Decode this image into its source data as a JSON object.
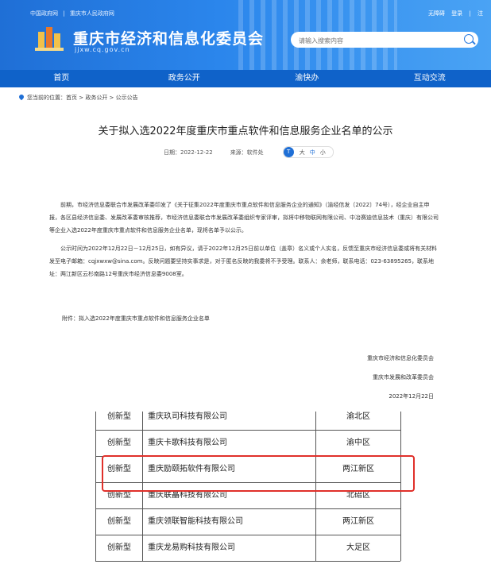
{
  "header": {
    "top_links": [
      "中国政府网",
      "|",
      "重庆市人民政府网"
    ],
    "user_links": [
      "无障碍",
      "登录",
      "|",
      "注"
    ],
    "site_title": "重庆市经济和信息化委员会",
    "site_url": "jjxw.cq.gov.cn",
    "search_placeholder": "请输入搜索内容"
  },
  "nav": {
    "items": [
      "首页",
      "政务公开",
      "渝快办",
      "互动交流"
    ]
  },
  "breadcrumb": "您当前的位置：首页 > 政务公开 > 公示公告",
  "article": {
    "title": "关于拟入选2022年度重庆市重点软件和信息服务企业名单的公示",
    "date": "日期：2022-12-22",
    "source": "来源：软件处",
    "font_sizes": [
      "大",
      "中",
      "小"
    ],
    "paragraphs": [
      "前期，市经济信息委联合市发展改革委印发了《关于征集2022年度重庆市重点软件和信息服务企业的通知》（渝经信发〔2022〕74号），经企业自主申报，各区县经济信息委、发展改革委审核推荐，市经济信息委联合市发展改革委组织专家评审，拟将中移物联网有限公司、中冶赛迪信息技术（重庆）有限公司等企业入选2022年度重庆市重点软件和信息服务企业名单，现将名单予以公示。",
      "公示时间为2022年12月22日－12月25日，如有异议，请于2022年12月25日前以单位（盖章）名义或个人实名，反馈至重庆市经济信息委或将有关材料发至电子邮箱：cqjxwxw@sina.com。反映问题要坚持实事求是，对于匿名反映的我委将不予受理。联系人：余老师，联系电话：023-63895265，联系地址：两江新区云杉南路12号重庆市经济信息委9008室。"
    ],
    "attachment": "附件：拟入选2022年度重庆市重点软件和信息服务企业名单",
    "signatures": [
      "重庆市经济和信息化委员会",
      "重庆市发展和改革委员会",
      "2022年12月22日"
    ]
  },
  "table": {
    "rows": [
      {
        "type": "创新型",
        "name": "重庆玖司科技有限公司",
        "district": "渝北区"
      },
      {
        "type": "创新型",
        "name": "重庆卡歌科技有限公司",
        "district": "渝中区"
      },
      {
        "type": "创新型",
        "name": "重庆励颐拓软件有限公司",
        "district": "两江新区"
      },
      {
        "type": "创新型",
        "name": "重庆联瞐科技有限公司",
        "district": "北碚区"
      },
      {
        "type": "创新型",
        "name": "重庆领联智能科技有限公司",
        "district": "两江新区"
      },
      {
        "type": "创新型",
        "name": "重庆龙易购科技有限公司",
        "district": "大足区"
      }
    ]
  },
  "colors": {
    "header_blue": "#2b86ec",
    "nav_blue": "#0f62c9",
    "highlight_red": "#e0302a"
  }
}
